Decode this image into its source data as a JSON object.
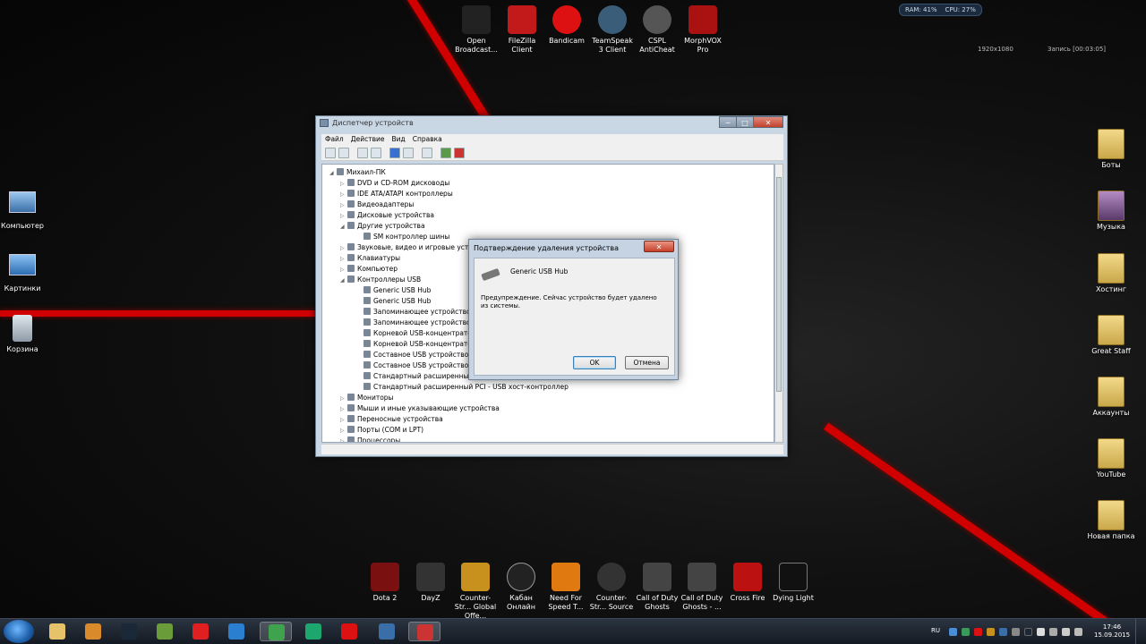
{
  "hud": {
    "ram": "RAM: 41%",
    "cpu": "CPU: 27%"
  },
  "recorder": {
    "res": "1920x1080",
    "rec": "Запись [00:03:05]"
  },
  "top_icons": [
    {
      "label": "Open Broadcast...",
      "color": "#222"
    },
    {
      "label": "FileZilla Client",
      "color": "#c21a1a"
    },
    {
      "label": "Bandicam",
      "color": "#d11"
    },
    {
      "label": "TeamSpeak 3 Client",
      "color": "#3a5e7a"
    },
    {
      "label": "CSPL AntiCheat",
      "color": "#555"
    },
    {
      "label": "MorphVOX Pro",
      "color": "#a11"
    }
  ],
  "left_icons": [
    {
      "label": "Компьютер"
    },
    {
      "label": "Картинки"
    },
    {
      "label": "Корзина"
    }
  ],
  "right_icons": [
    {
      "label": "Боты"
    },
    {
      "label": "Музыка"
    },
    {
      "label": "Хостинг"
    },
    {
      "label": "Great Staff"
    },
    {
      "label": "Аккаунты"
    },
    {
      "label": "YouTube"
    },
    {
      "label": "Новая папка"
    }
  ],
  "bottom_icons": [
    {
      "label": "Dota 2",
      "color": "#7a1010"
    },
    {
      "label": "DayZ",
      "color": "#333"
    },
    {
      "label": "Counter-Str... Global Offe...",
      "color": "#c8911e"
    },
    {
      "label": "Кабан Онлайн",
      "color": "#222"
    },
    {
      "label": "Need For Speed T...",
      "color": "#e07a10"
    },
    {
      "label": "Counter-Str... Source",
      "color": "#333"
    },
    {
      "label": "Call of Duty Ghosts",
      "color": "#444"
    },
    {
      "label": "Call of Duty Ghosts - ...",
      "color": "#444"
    },
    {
      "label": "Cross Fire",
      "color": "#b11"
    },
    {
      "label": "Dying Light",
      "color": "#111"
    }
  ],
  "window": {
    "title": "Диспетчер устройств",
    "menu": [
      "Файл",
      "Действие",
      "Вид",
      "Справка"
    ],
    "tree": [
      {
        "label": "Михаил-ПК",
        "level": 0,
        "exp": "◢"
      },
      {
        "label": "DVD и CD-ROM дисководы",
        "level": 1,
        "exp": "▷"
      },
      {
        "label": "IDE ATA/ATAPI контроллеры",
        "level": 1,
        "exp": "▷"
      },
      {
        "label": "Видеоадаптеры",
        "level": 1,
        "exp": "▷"
      },
      {
        "label": "Дисковые устройства",
        "level": 1,
        "exp": "▷"
      },
      {
        "label": "Другие устройства",
        "level": 1,
        "exp": "◢"
      },
      {
        "label": "SM контроллер шины",
        "level": 2,
        "exp": ""
      },
      {
        "label": "Звуковые, видео и игровые устройства",
        "level": 1,
        "exp": "▷"
      },
      {
        "label": "Клавиатуры",
        "level": 1,
        "exp": "▷"
      },
      {
        "label": "Компьютер",
        "level": 1,
        "exp": "▷"
      },
      {
        "label": "Контроллеры USB",
        "level": 1,
        "exp": "◢"
      },
      {
        "label": "Generic USB Hub",
        "level": 2,
        "exp": ""
      },
      {
        "label": "Generic USB Hub",
        "level": 2,
        "exp": ""
      },
      {
        "label": "Запоминающее устройство д",
        "level": 2,
        "exp": ""
      },
      {
        "label": "Запоминающее устройство д",
        "level": 2,
        "exp": ""
      },
      {
        "label": "Корневой USB-концентратор",
        "level": 2,
        "exp": ""
      },
      {
        "label": "Корневой USB-концентратор",
        "level": 2,
        "exp": ""
      },
      {
        "label": "Составное USB устройство",
        "level": 2,
        "exp": ""
      },
      {
        "label": "Составное USB устройство",
        "level": 2,
        "exp": ""
      },
      {
        "label": "Стандартный расширенный P",
        "level": 2,
        "exp": ""
      },
      {
        "label": "Стандартный расширенный PCI - USB хост-контроллер",
        "level": 2,
        "exp": ""
      },
      {
        "label": "Мониторы",
        "level": 1,
        "exp": "▷"
      },
      {
        "label": "Мыши и иные указывающие устройства",
        "level": 1,
        "exp": "▷"
      },
      {
        "label": "Переносные устройства",
        "level": 1,
        "exp": "▷"
      },
      {
        "label": "Порты (COM и LPT)",
        "level": 1,
        "exp": "▷"
      },
      {
        "label": "Процессоры",
        "level": 1,
        "exp": "▷"
      }
    ]
  },
  "dialog": {
    "title": "Подтверждение удаления устройства",
    "device": "Generic USB Hub",
    "warning": "Предупреждение. Сейчас устройство будет удалено из системы.",
    "ok": "OK",
    "cancel": "Отмена"
  },
  "taskbar": {
    "apps": [
      {
        "name": "explorer",
        "color": "#e6c36a"
      },
      {
        "name": "media-player",
        "color": "#d98a2a"
      },
      {
        "name": "steam",
        "color": "#1b2838"
      },
      {
        "name": "archive",
        "color": "#6a9c3a"
      },
      {
        "name": "yandex-browser",
        "color": "#e02020"
      },
      {
        "name": "mail-agent",
        "color": "#2a7fd1"
      },
      {
        "name": "chrome",
        "color": "#3fa34d"
      },
      {
        "name": "kaspersky",
        "color": "#1ea66f"
      },
      {
        "name": "bandicam",
        "color": "#d11"
      },
      {
        "name": "teamspeak",
        "color": "#3a6ea8"
      },
      {
        "name": "device-manager",
        "color": "#c33"
      }
    ],
    "lang": "RU",
    "time": "17:46",
    "date": "15.09.2015"
  }
}
